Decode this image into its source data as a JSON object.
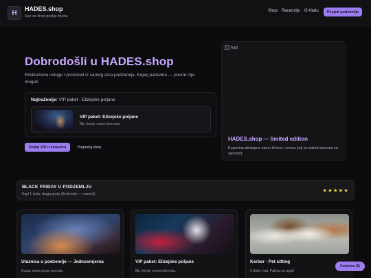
{
  "header": {
    "logo_letter": "H",
    "brand": "HADES.shop",
    "tagline": "Sve za život poslije života",
    "nav": [
      "Shop",
      "Recenzije",
      "O Hadu"
    ],
    "cta": "Posjeti podzemlje"
  },
  "hero": {
    "title": "Dobrodošli u HADES.shop",
    "description": "Ekskluzivne usluge i proizvodi iz samog srca podzemlja. Kupuj pametno — povrat nije moguć.",
    "featured_label": "Najtraženije:",
    "featured_value": "VIP paket - Elizejske poljane",
    "featured_item": {
      "name": "VIP paket: Elizejske poljane",
      "subtitle": "Mir, heroji, nema interneta."
    },
    "add_button": "Dodaj VIP u košaricu",
    "view_button": "Pogledaj shop"
  },
  "hero_card": {
    "broken_alt": "had",
    "title": "HADES.shop — limited edition",
    "description": "Kupovina dostupna samo živima i onima koji su zainteresovani za vječnost."
  },
  "banner": {
    "title": "BLACK FRIDAY U PODZEMLJU",
    "subtitle": "Kupi 1 dušu, druga gratis (ili obrnuto — razmisli).",
    "stars": "★★★★★",
    "rating": 5
  },
  "products": [
    {
      "name": "Ulaznica u podzemlje — Jednosmjerna",
      "description": "Kupac nema pravo povrata."
    },
    {
      "name": "VIP paket: Elizejske poljane",
      "description": "Mir, heroji, nema interneta."
    },
    {
      "name": "Kerber - Pet sitting",
      "description": "3 duše / sat. Pažnja na ugriz!"
    }
  ],
  "cart": {
    "label": "Košarica (0)"
  },
  "colors": {
    "accent": "#9b7df0",
    "title": "#c9a8ff",
    "background": "#0c0c0e",
    "stars": "#f2c84b"
  }
}
